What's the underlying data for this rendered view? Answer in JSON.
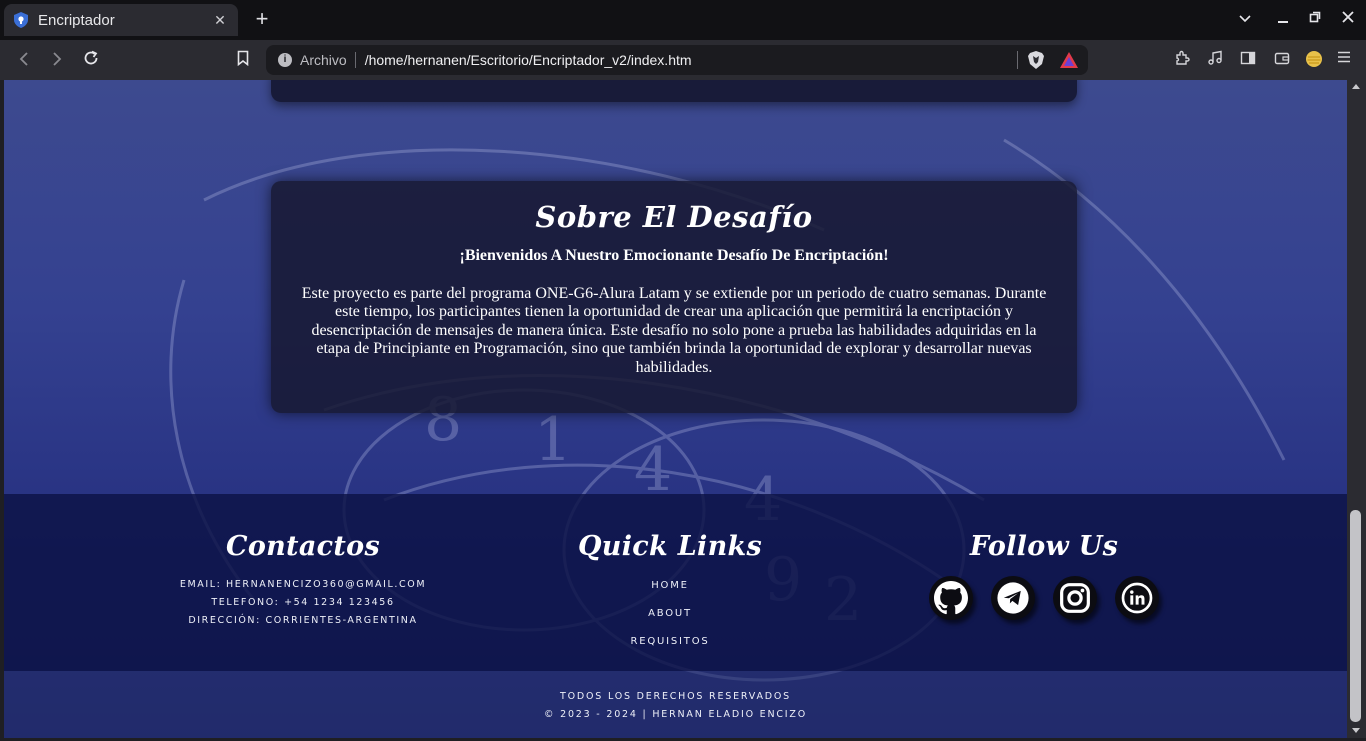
{
  "browser": {
    "tab_title": "Encriptador",
    "tab_close": "✕",
    "new_tab": "+",
    "omnibox_label": "Archivo",
    "url": "/home/hernanen/Escritorio/Encriptador_v2/index.htm",
    "icons": [
      "back-icon",
      "forward-icon",
      "reload-icon",
      "bookmark-icon",
      "info-icon",
      "brave-shield-icon",
      "brave-rewards-icon",
      "extensions-icon",
      "media-icon",
      "sidebar-icon",
      "wallet-icon",
      "profile-icon",
      "menu-icon"
    ]
  },
  "about": {
    "title": "Sobre El Desafío",
    "subtitle": "¡Bienvenidos A Nuestro Emocionante Desafío De Encriptación!",
    "text": "Este proyecto es parte del programa ONE-G6-Alura Latam y se extiende por un periodo de cuatro semanas. Durante este tiempo, los participantes tienen la oportunidad de crear una aplicación que permitirá la encriptación y desencriptación de mensajes de manera única. Este desafío no solo pone a prueba las habilidades adquiridas en la etapa de Principiante en Programación, sino que también brinda la oportunidad de explorar y desarrollar nuevas habilidades."
  },
  "footer": {
    "contacts": {
      "heading": "Contactos",
      "email": "EMAIL: HERNANENCIZO360@GMAIL.COM",
      "phone": "TELEFONO: +54 1234 123456",
      "address": "DIRECCIÓN: CORRIENTES-ARGENTINA"
    },
    "quick_links": {
      "heading": "Quick Links",
      "items": [
        "HOME",
        "ABOUT",
        "REQUISITOS"
      ]
    },
    "follow": {
      "heading": "Follow Us",
      "icons": [
        "github-icon",
        "telegram-icon",
        "instagram-icon",
        "linkedin-icon"
      ]
    }
  },
  "copyright": {
    "line1": "TODOS LOS DERECHOS RESERVADOS",
    "line2": "© 2023 - 2024 | HERNAN ELADIO ENCIZO"
  },
  "colors": {
    "page_bg_top": "#3d4a8f",
    "card_bg": "#171832",
    "footer_bg": "#0c1246",
    "chrome_dark": "#111114",
    "chrome_toolbar": "#2b2b31"
  }
}
